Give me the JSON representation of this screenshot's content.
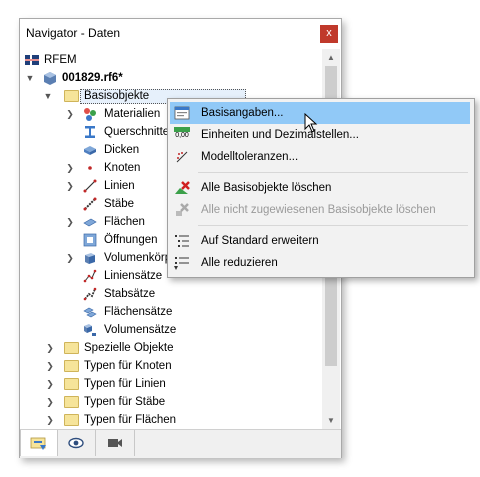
{
  "window": {
    "title": "Navigator - Daten",
    "close_glyph": "x"
  },
  "tree": {
    "root": "RFEM",
    "model": "001829.rf6*",
    "basis": "Basisobjekte",
    "basis_children": [
      "Materialien",
      "Querschnitte",
      "Dicken",
      "Knoten",
      "Linien",
      "Stäbe",
      "Flächen",
      "Öffnungen",
      "Volumenkörper",
      "Liniensätze",
      "Stabsätze",
      "Flächensätze",
      "Volumensätze"
    ],
    "folders": [
      "Spezielle Objekte",
      "Typen für Knoten",
      "Typen für Linien",
      "Typen für Stäbe",
      "Typen für Flächen"
    ]
  },
  "context_menu": {
    "items": [
      "Basisangaben...",
      "Einheiten und Dezimalstellen...",
      "Modelltoleranzen...",
      "Alle Basisobjekte löschen",
      "Alle nicht zugewiesenen Basisobjekte löschen",
      "Auf Standard erweitern",
      "Alle reduzieren"
    ],
    "icon_text_units": "0,00"
  },
  "icons": {
    "tabs": [
      "data-icon",
      "eye-icon",
      "camera-icon"
    ]
  },
  "colors": {
    "highlight": "#91c9f7",
    "close": "#c0392b",
    "folder": "#f6e49a"
  }
}
